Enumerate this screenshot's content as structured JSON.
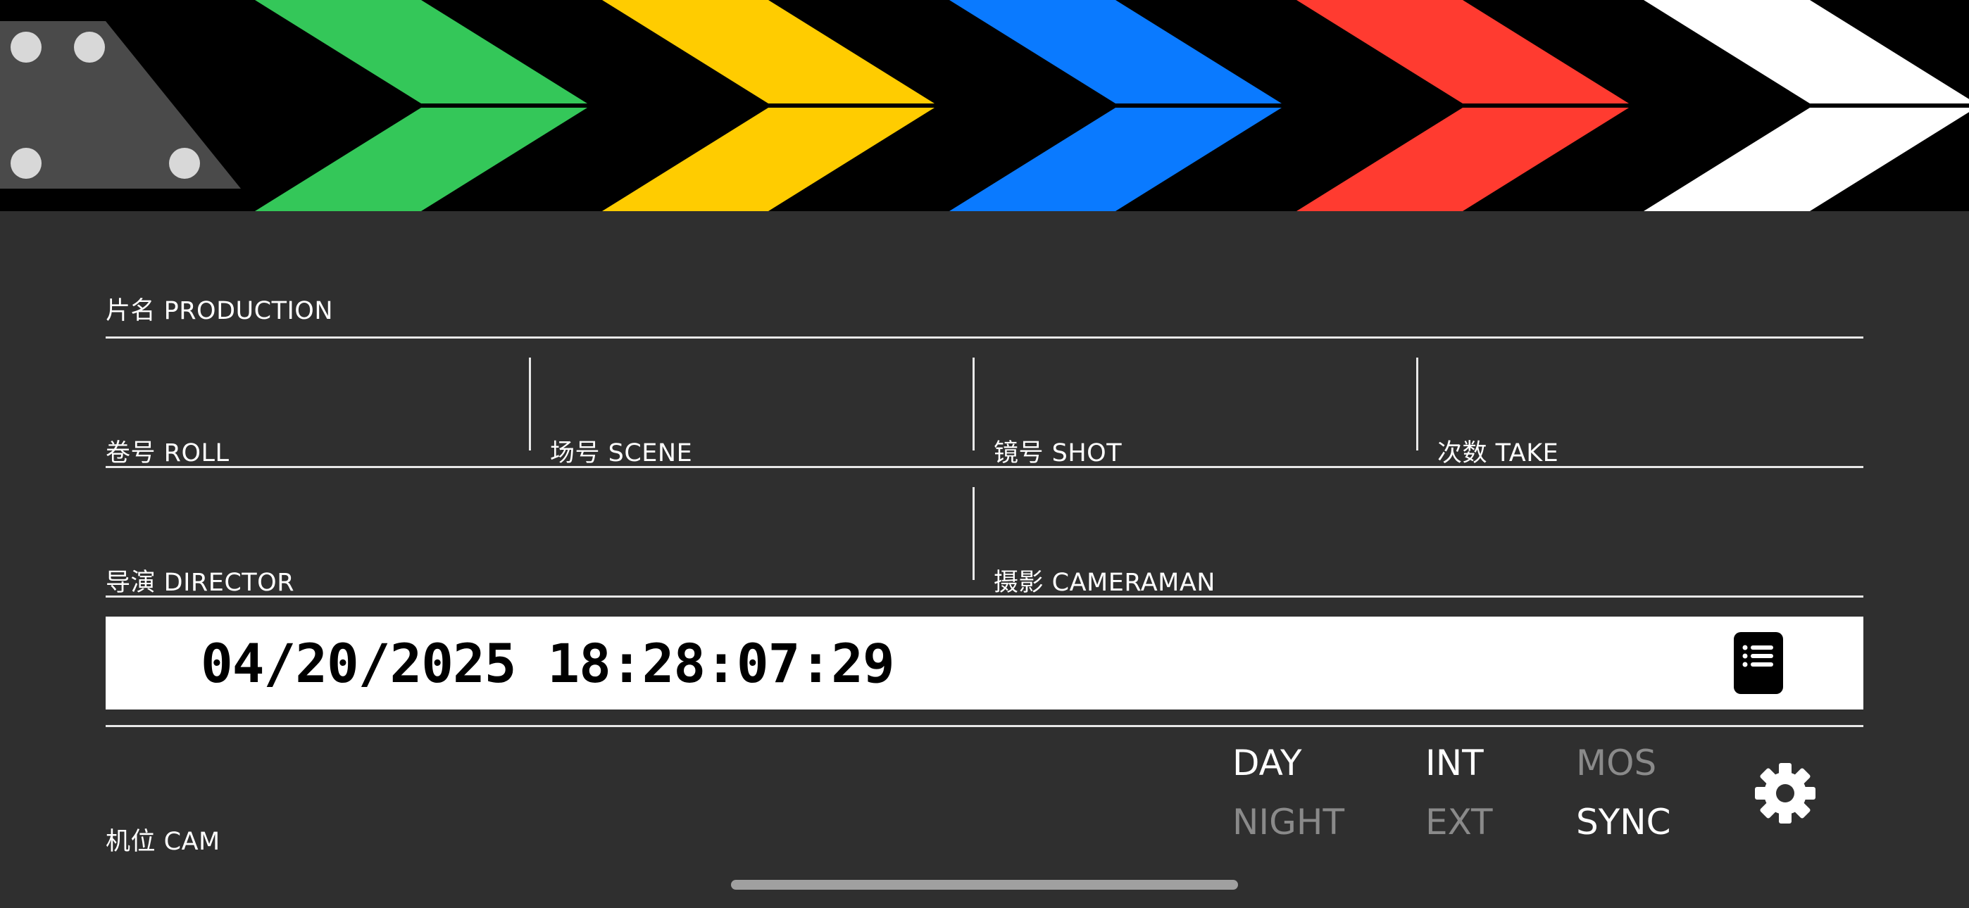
{
  "clapper": {
    "stripe_colors": [
      "#34c759",
      "#ffcc00",
      "#0a7aff",
      "#ff3b30",
      "#ffffff"
    ]
  },
  "slate": {
    "production_label": "片名 PRODUCTION",
    "roll_label": "卷号 ROLL",
    "scene_label": "场号 SCENE",
    "shot_label": "镜号 SHOT",
    "take_label": "次数 TAKE",
    "director_label": "导演 DIRECTOR",
    "cameraman_label": "摄影 CAMERAMAN",
    "cam_label": "机位 CAM"
  },
  "timecode": {
    "value": "04/20/2025 18:28:07:29"
  },
  "toggles": {
    "day": {
      "label": "DAY",
      "active": true
    },
    "night": {
      "label": "NIGHT",
      "active": false
    },
    "int": {
      "label": "INT",
      "active": true
    },
    "ext": {
      "label": "EXT",
      "active": false
    },
    "mos": {
      "label": "MOS",
      "active": false
    },
    "sync": {
      "label": "SYNC",
      "active": true
    }
  },
  "icons": {
    "notes": "list-document-icon",
    "settings": "gear-icon"
  }
}
